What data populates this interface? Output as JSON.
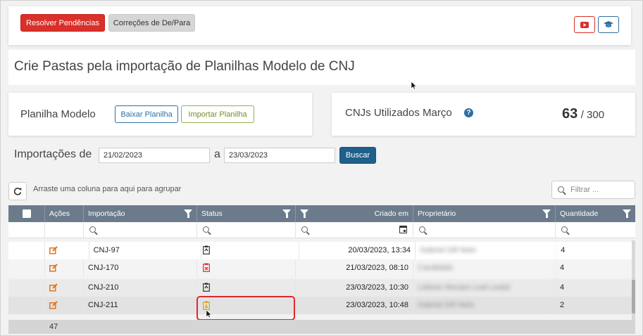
{
  "toolbar": {
    "resolve_label": "Resolver Pendências",
    "corrections_label": "Correções de De/Para"
  },
  "page": {
    "title": "Crie Pastas pela importação de Planilhas Modelo de CNJ"
  },
  "planilha": {
    "label": "Planilha Modelo",
    "download_label": "Baixar Planilha",
    "import_label": "Importar Planilha"
  },
  "usage": {
    "label": "CNJs Utilizados Março",
    "used": "63",
    "total": "/ 300"
  },
  "imports": {
    "label": "Importações de",
    "date_from": "21/02/2023",
    "separator": "a",
    "date_to": "23/03/2023",
    "search_label": "Buscar"
  },
  "grid": {
    "group_hint": "Arraste uma coluna para aqui para agrupar",
    "filter_placeholder": "Filtrar ...",
    "columns": {
      "acoes": "Ações",
      "importacao": "Importação",
      "status": "Status",
      "criado": "Criado em",
      "proprietario": "Proprietário",
      "quantidade": "Quantidade"
    },
    "rows": [
      {
        "importacao": "CNJ-97",
        "criado": "20/03/2023, 13:34",
        "proprietario": "Gabriel Dill Neto",
        "quantidade": "4"
      },
      {
        "importacao": "CNJ-170",
        "criado": "21/03/2023, 08:10",
        "proprietario": "Candidato",
        "quantidade": "4"
      },
      {
        "importacao": "CNJ-210",
        "criado": "23/03/2023, 10:30",
        "proprietario": "Lidiane Moraes Leal Lealst",
        "quantidade": "4"
      },
      {
        "importacao": "CNJ-211",
        "criado": "23/03/2023, 10:48",
        "proprietario": "Gabriel Dill Neto",
        "quantidade": "2"
      }
    ],
    "total_count": "47"
  },
  "colors": {
    "red": "#d9302a",
    "header": "#6b7b8c",
    "highlight": "#e0282e",
    "status_warning": "#e0a020",
    "status_error": "#d9302a"
  }
}
